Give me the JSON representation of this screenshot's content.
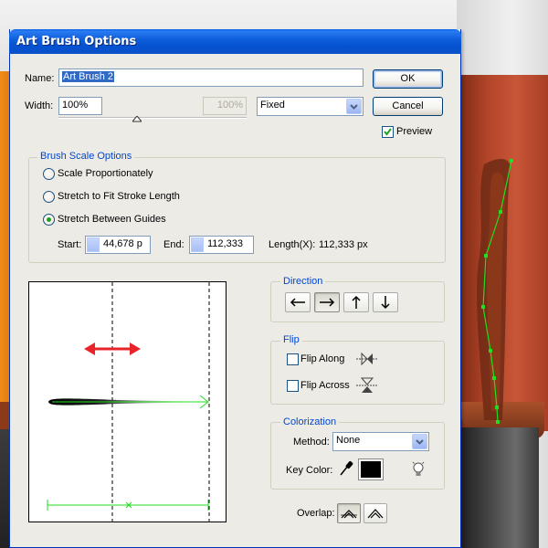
{
  "dialog": {
    "title": "Art Brush Options",
    "name_label": "Name:",
    "name_value": "Art Brush 2",
    "ok_label": "OK",
    "cancel_label": "Cancel",
    "width_label": "Width:",
    "width_value": "100%",
    "width_max_value": "100%",
    "width_mode": "Fixed",
    "preview_label": "Preview",
    "preview_checked": true
  },
  "brush_scale": {
    "title": "Brush Scale Options",
    "options": [
      "Scale Proportionately",
      "Stretch to Fit Stroke Length",
      "Stretch Between Guides"
    ],
    "selected_index": 2,
    "start_label": "Start:",
    "start_value": "44,678 p",
    "end_label": "End:",
    "end_value": "112,333",
    "length_label": "Length(X):",
    "length_value": "112,333 px"
  },
  "direction": {
    "title": "Direction",
    "buttons": [
      "left-arrow",
      "right-arrow",
      "up-arrow",
      "down-arrow"
    ],
    "selected_index": 1
  },
  "flip": {
    "title": "Flip",
    "along_label": "Flip Along",
    "across_label": "Flip Across",
    "along_checked": false,
    "across_checked": false
  },
  "colorization": {
    "title": "Colorization",
    "method_label": "Method:",
    "method_value": "None",
    "key_color_label": "Key Color:",
    "key_color": "#000000"
  },
  "overlap": {
    "label": "Overlap:",
    "selected_index": 0
  },
  "colors": {
    "title_bar": "#0b53c9",
    "dialog_bg": "#ecebe6",
    "group_title": "#0046d5",
    "guide_green": "#22dd22",
    "arrow_red": "#e8242a"
  }
}
